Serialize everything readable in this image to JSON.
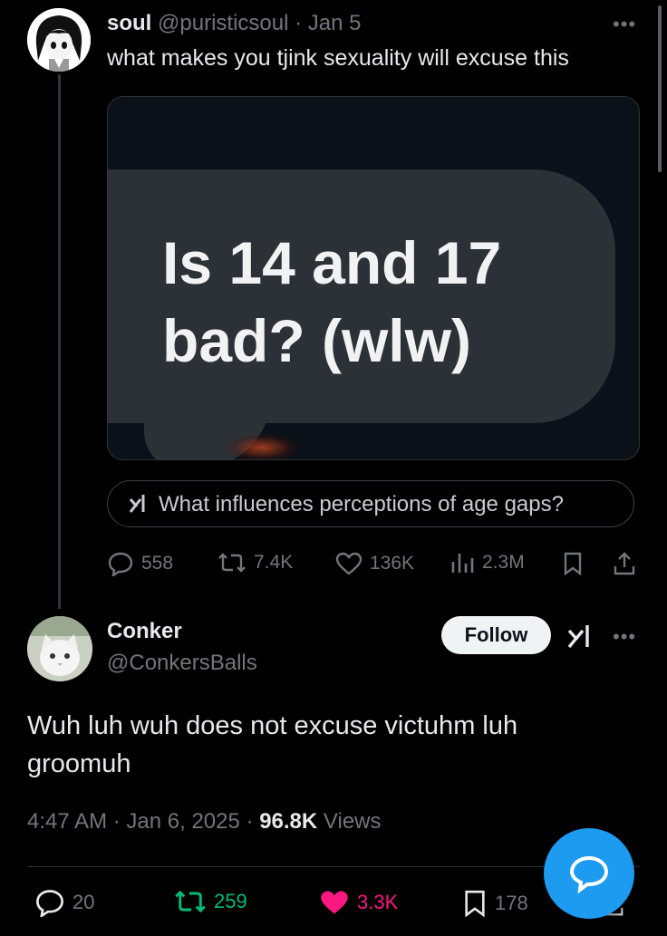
{
  "tweet1": {
    "display_name": "soul",
    "handle": "@puristicsoul",
    "separator": "·",
    "date": "Jan 5",
    "text": "what makes you tjink sexuality will excuse this",
    "media_text": "Is 14 and 17\nbad? (wlw)",
    "grok_prompt": "What influences perceptions of age gaps?",
    "replies": "558",
    "reposts": "7.4K",
    "likes": "136K",
    "views": "2.3M"
  },
  "tweet2": {
    "display_name": "Conker",
    "handle": "@ConkersBalls",
    "follow_label": "Follow",
    "text": "Wuh luh wuh does not excuse victuhm luh groomuh",
    "time": "4:47 AM",
    "date": "Jan 6, 2025",
    "views_count": "96.8K",
    "views_label": "Views",
    "replies": "20",
    "reposts": "259",
    "likes": "3.3K",
    "bookmarks": "178"
  },
  "colors": {
    "background": "#000000",
    "text": "#e7e9ea",
    "muted": "#71767b",
    "repost_active": "#00ba7c",
    "like_active": "#f91880",
    "accent": "#1d9bf0"
  }
}
